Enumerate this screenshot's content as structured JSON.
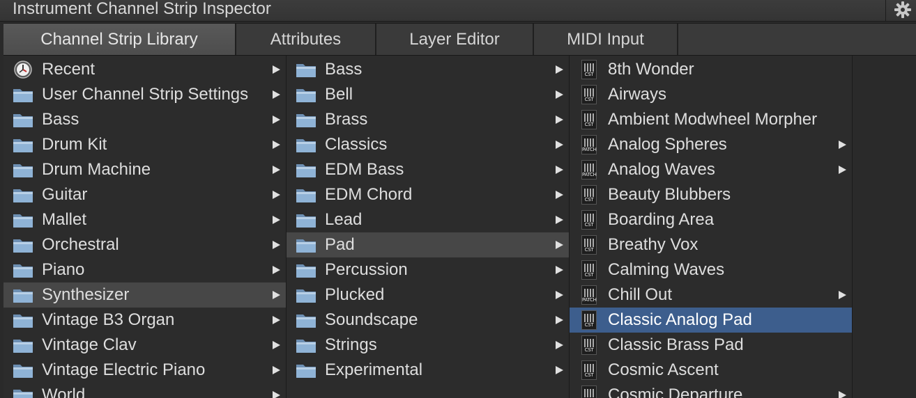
{
  "window": {
    "title": "Instrument Channel Strip Inspector"
  },
  "tabs": [
    {
      "label": "Channel Strip Library",
      "active": true
    },
    {
      "label": "Attributes",
      "active": false
    },
    {
      "label": "Layer Editor",
      "active": false
    },
    {
      "label": "MIDI Input",
      "active": false
    }
  ],
  "columns": {
    "categories": [
      {
        "label": "Recent",
        "icon": "clock-icon",
        "submenu": true
      },
      {
        "label": "User Channel Strip Settings",
        "icon": "folder-icon",
        "submenu": true
      },
      {
        "label": "Bass",
        "icon": "folder-icon",
        "submenu": true
      },
      {
        "label": "Drum Kit",
        "icon": "folder-icon",
        "submenu": true
      },
      {
        "label": "Drum Machine",
        "icon": "folder-icon",
        "submenu": true
      },
      {
        "label": "Guitar",
        "icon": "folder-icon",
        "submenu": true
      },
      {
        "label": "Mallet",
        "icon": "folder-icon",
        "submenu": true
      },
      {
        "label": "Orchestral",
        "icon": "folder-icon",
        "submenu": true
      },
      {
        "label": "Piano",
        "icon": "folder-icon",
        "submenu": true
      },
      {
        "label": "Synthesizer",
        "icon": "folder-icon",
        "submenu": true,
        "selected": true
      },
      {
        "label": "Vintage B3 Organ",
        "icon": "folder-icon",
        "submenu": true
      },
      {
        "label": "Vintage Clav",
        "icon": "folder-icon",
        "submenu": true
      },
      {
        "label": "Vintage Electric Piano",
        "icon": "folder-icon",
        "submenu": true
      },
      {
        "label": "World",
        "icon": "folder-icon",
        "submenu": true
      }
    ],
    "subcategories": [
      {
        "label": "Bass",
        "icon": "folder-icon",
        "submenu": true
      },
      {
        "label": "Bell",
        "icon": "folder-icon",
        "submenu": true
      },
      {
        "label": "Brass",
        "icon": "folder-icon",
        "submenu": true
      },
      {
        "label": "Classics",
        "icon": "folder-icon",
        "submenu": true
      },
      {
        "label": "EDM Bass",
        "icon": "folder-icon",
        "submenu": true
      },
      {
        "label": "EDM Chord",
        "icon": "folder-icon",
        "submenu": true
      },
      {
        "label": "Lead",
        "icon": "folder-icon",
        "submenu": true
      },
      {
        "label": "Pad",
        "icon": "folder-icon",
        "submenu": true,
        "selected": true
      },
      {
        "label": "Percussion",
        "icon": "folder-icon",
        "submenu": true
      },
      {
        "label": "Plucked",
        "icon": "folder-icon",
        "submenu": true
      },
      {
        "label": "Soundscape",
        "icon": "folder-icon",
        "submenu": true
      },
      {
        "label": "Strings",
        "icon": "folder-icon",
        "submenu": true
      },
      {
        "label": "Experimental",
        "icon": "folder-icon",
        "submenu": true
      }
    ],
    "patches": [
      {
        "label": "8th Wonder",
        "icon": "cst-file-icon",
        "tag": "CST",
        "submenu": false
      },
      {
        "label": "Airways",
        "icon": "cst-file-icon",
        "tag": "CST",
        "submenu": false
      },
      {
        "label": "Ambient Modwheel Morpher",
        "icon": "cst-file-icon",
        "tag": "CST",
        "submenu": false
      },
      {
        "label": "Analog Spheres",
        "icon": "patch-file-icon",
        "tag": "PATCH",
        "submenu": true
      },
      {
        "label": "Analog Waves",
        "icon": "patch-file-icon",
        "tag": "PATCH",
        "submenu": true
      },
      {
        "label": "Beauty Blubbers",
        "icon": "cst-file-icon",
        "tag": "CST",
        "submenu": false
      },
      {
        "label": "Boarding Area",
        "icon": "cst-file-icon",
        "tag": "CST",
        "submenu": false
      },
      {
        "label": "Breathy Vox",
        "icon": "cst-file-icon",
        "tag": "CST",
        "submenu": false
      },
      {
        "label": "Calming Waves",
        "icon": "cst-file-icon",
        "tag": "CST",
        "submenu": false
      },
      {
        "label": "Chill Out",
        "icon": "patch-file-icon",
        "tag": "PATCH",
        "submenu": true
      },
      {
        "label": "Classic Analog Pad",
        "icon": "cst-file-icon",
        "tag": "CST",
        "submenu": false,
        "selected": true
      },
      {
        "label": "Classic Brass Pad",
        "icon": "cst-file-icon",
        "tag": "CST",
        "submenu": false
      },
      {
        "label": "Cosmic Ascent",
        "icon": "cst-file-icon",
        "tag": "CST",
        "submenu": false
      },
      {
        "label": "Cosmic Departure",
        "icon": "patch-file-icon",
        "tag": "CST",
        "submenu": true
      }
    ]
  },
  "colors": {
    "selection_blue": "#3d5e8d",
    "selection_gray": "#474747",
    "folder_blue": "#8fb3d6"
  }
}
